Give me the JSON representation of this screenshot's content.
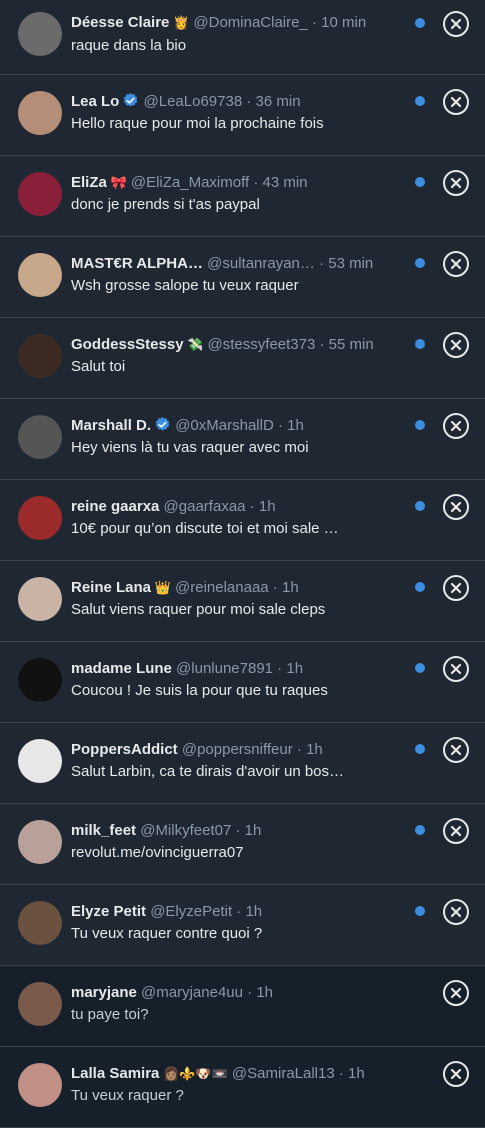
{
  "accent": "#3b8ee0",
  "conversations": [
    {
      "name": "Déesse Claire",
      "emoji": "👸",
      "verified": false,
      "handle": "@DominaClaire_",
      "time": "10 min",
      "message": "raque dans la bio",
      "unread": true,
      "avatar_color": "#6b6b6b"
    },
    {
      "name": "Lea Lo",
      "emoji": "",
      "verified": true,
      "handle": "@LeaLo69738",
      "time": "36 min",
      "message": "Hello raque pour moi la prochaine fois",
      "unread": true,
      "avatar_color": "#b58e7a"
    },
    {
      "name": "EliZa",
      "emoji": "🎀",
      "verified": false,
      "handle": "@EliZa_Maximoff",
      "time": "43 min",
      "message": "donc je prends si t'as paypal",
      "unread": true,
      "avatar_color": "#8a1f3a"
    },
    {
      "name": "MAST€R ALPHA…",
      "emoji": "",
      "verified": false,
      "handle": "@sultanrayan…",
      "time": "53 min",
      "message": "Wsh grosse salope tu veux raquer",
      "unread": true,
      "avatar_color": "#c7a88a"
    },
    {
      "name": "GoddessStessy",
      "emoji": "💸",
      "verified": false,
      "handle": "@stessyfeet373",
      "time": "55 min",
      "message": "Salut toi",
      "unread": true,
      "avatar_color": "#3a2a22"
    },
    {
      "name": "Marshall D.",
      "emoji": "",
      "verified": true,
      "handle": "@0xMarshallD",
      "time": "1h",
      "message": "Hey viens là tu vas raquer avec moi",
      "unread": true,
      "avatar_color": "#555555"
    },
    {
      "name": "reine gaarxa",
      "emoji": "",
      "verified": false,
      "handle": "@gaarfaxaa",
      "time": "1h",
      "message": "10€ pour qu’on discute toi et moi sale …",
      "unread": true,
      "avatar_color": "#9b2b2b"
    },
    {
      "name": "Reine Lana",
      "emoji": "👑",
      "verified": false,
      "handle": "@reinelanaaa",
      "time": "1h",
      "message": "Salut viens raquer pour moi sale cleps",
      "unread": true,
      "avatar_color": "#c9b3a5"
    },
    {
      "name": "madame Lune",
      "emoji": "",
      "verified": false,
      "handle": "@lunlune7891",
      "time": "1h",
      "message": "Coucou ! Je suis la pour que tu raques",
      "unread": true,
      "avatar_color": "#111111"
    },
    {
      "name": "PoppersAddict",
      "emoji": "",
      "verified": false,
      "handle": "@poppersniffeur",
      "time": "1h",
      "message": "Salut Larbin, ca te dirais d'avoir un bos…",
      "unread": true,
      "avatar_color": "#e8e8e8"
    },
    {
      "name": "milk_feet",
      "emoji": "",
      "verified": false,
      "handle": "@Milkyfeet07",
      "time": "1h",
      "message": "revolut.me/ovinciguerra07",
      "unread": true,
      "avatar_color": "#b9a19a"
    },
    {
      "name": "Elyze Petit",
      "emoji": "",
      "verified": false,
      "handle": "@ElyzePetit",
      "time": "1h",
      "message": "Tu veux raquer contre quoi ?",
      "unread": true,
      "avatar_color": "#6a5140"
    },
    {
      "name": "maryjane",
      "emoji": "",
      "verified": false,
      "handle": "@maryjane4uu",
      "time": "1h",
      "message": "tu paye toi?",
      "unread": false,
      "avatar_color": "#7a5a4a"
    },
    {
      "name": "Lalla Samira",
      "emoji": "👩🏽⚜️🐶📼",
      "verified": false,
      "handle": "@SamiraLall13",
      "time": "1h",
      "message": "Tu veux raquer ?",
      "unread": false,
      "avatar_color": "#c08f86"
    }
  ]
}
